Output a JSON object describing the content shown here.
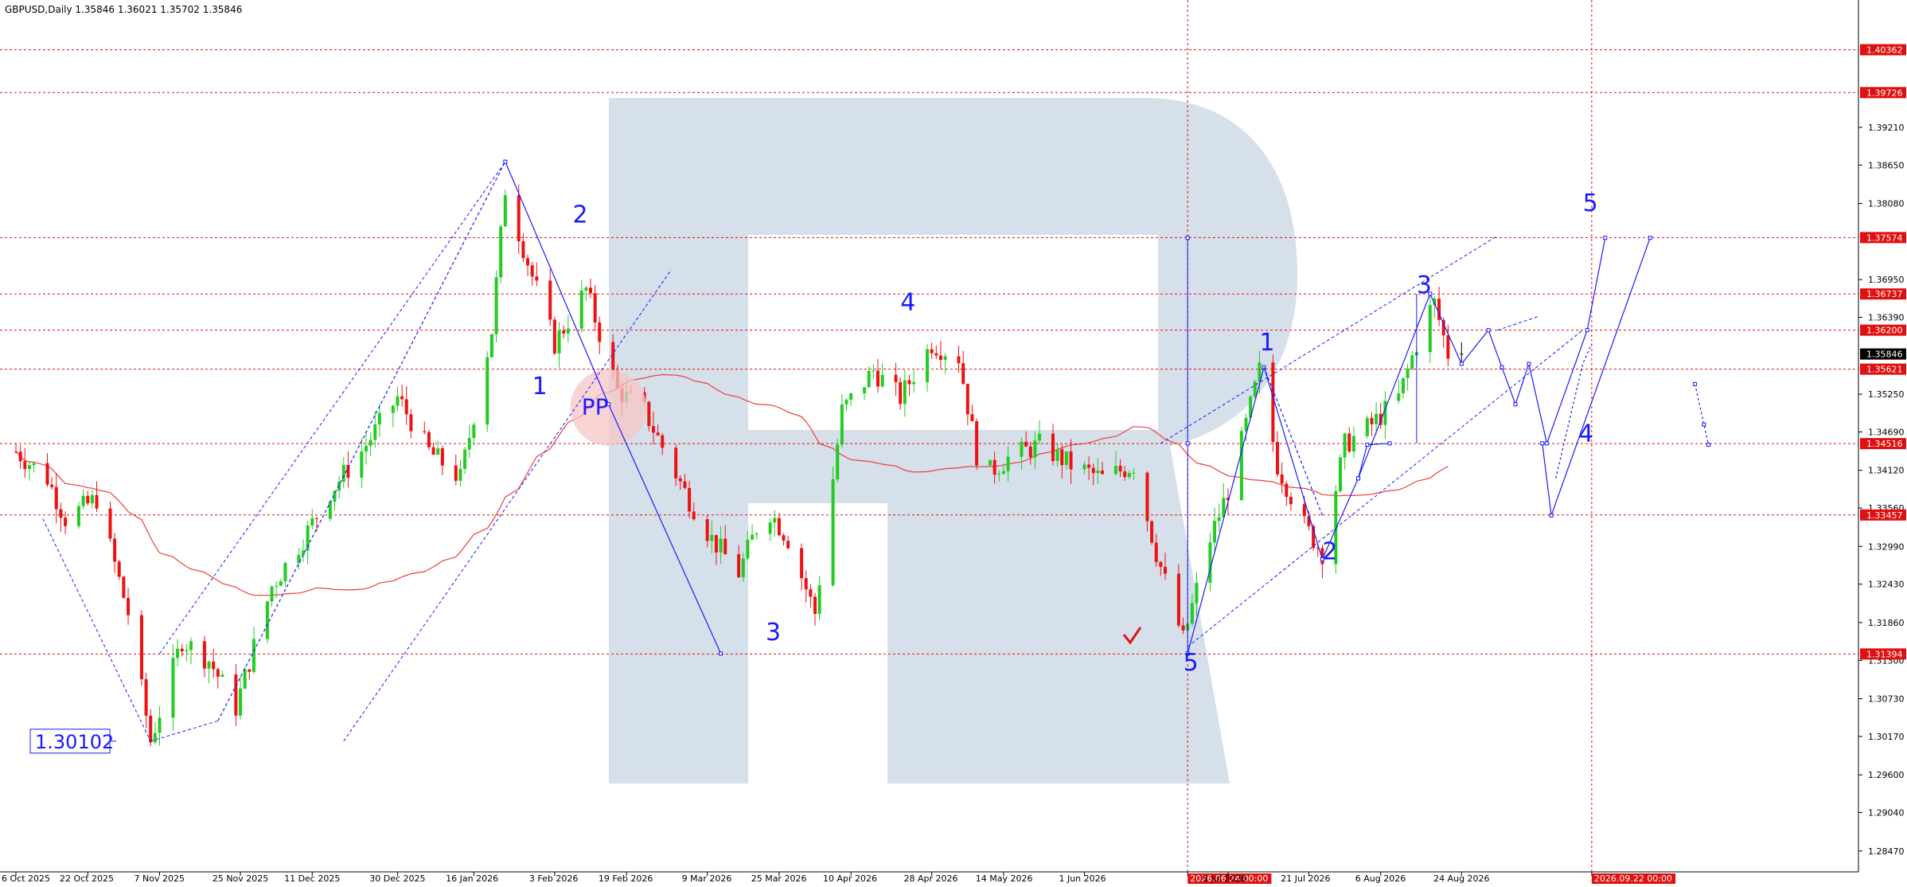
{
  "header": {
    "symbol_line": "GBPUSD,Daily  1.35846 1.36021 1.35702 1.35846"
  },
  "chart_data": {
    "type": "candlestick",
    "title": "GBPUSD,Daily",
    "ohlc": {
      "open": 1.35846,
      "high": 1.36021,
      "low": 1.35702,
      "close": 1.35846
    },
    "ylim": [
      1.2816,
      1.411
    ],
    "price_ticks": [
      "1.39210",
      "1.38650",
      "1.38080",
      "1.36950",
      "1.36390",
      "1.35250",
      "1.34690",
      "1.34120",
      "1.33560",
      "1.32990",
      "1.32430",
      "1.31860",
      "1.31300",
      "1.30730",
      "1.30170",
      "1.29600",
      "1.29040",
      "1.28470"
    ],
    "date_ticks": [
      "6 Oct 2025",
      "22 Oct 2025",
      "7 Nov 2025",
      "25 Nov 2025",
      "11 Dec 2025",
      "30 Dec 2025",
      "16 Jan 2026",
      "3 Feb 2026",
      "19 Feb 2026",
      "9 Mar 2026",
      "25 Mar 2026",
      "10 Apr 2026",
      "28 Apr 2026",
      "14 May 2026",
      "1 Jun 2026",
      "2026.06.24 00:00",
      "3 Jul 2026",
      "21 Jul 2026",
      "6 Aug 2026",
      "24 Aug 2026",
      "2026.09.22 00:00"
    ],
    "highlighted_dates": [
      "2026.06.24 00:00",
      "2026.09.22 00:00"
    ],
    "levels": [
      {
        "value": 1.40362,
        "label": "1.40362"
      },
      {
        "value": 1.39726,
        "label": "1.39726"
      },
      {
        "value": 1.37574,
        "label": "1.37574"
      },
      {
        "value": 1.36737,
        "label": "1.36737"
      },
      {
        "value": 1.362,
        "label": "1.36200"
      },
      {
        "value": 1.35621,
        "label": "1.35621"
      },
      {
        "value": 1.34516,
        "label": "1.34516"
      },
      {
        "value": 1.33457,
        "label": "1.33457"
      },
      {
        "value": 1.31394,
        "label": "1.31394"
      }
    ],
    "current_price": {
      "value": 1.35846,
      "label": "1.35846"
    },
    "price_callout": "1.30102",
    "pp_label": "PP",
    "wave_labels": [
      {
        "text": "1",
        "x": "29 Jan 2026",
        "y": 1.3525
      },
      {
        "text": "2",
        "x": "7 Feb 2026",
        "y": 1.378
      },
      {
        "text": "3",
        "x": "22 Mar 2026",
        "y": 1.316
      },
      {
        "text": "4",
        "x": "21 Apr 2026",
        "y": 1.365
      },
      {
        "text": "5",
        "x": "23 Jun 2026",
        "y": 1.3115
      },
      {
        "text": "1",
        "x": "10 Jul 2026",
        "y": 1.359
      },
      {
        "text": "2",
        "x": "24 Jul 2026",
        "y": 1.328
      },
      {
        "text": "3",
        "x": "14 Aug 2026",
        "y": 1.3675
      },
      {
        "text": "4",
        "x": "19 Sep 2026",
        "y": 1.3455
      },
      {
        "text": "5",
        "x": "20 Sep 2026",
        "y": 1.3797
      }
    ],
    "colors": {
      "bull": "#22cc22",
      "bear": "#ee1111",
      "ma": "#ee3b3b",
      "wave": "#1a1aff",
      "level": "#e01010",
      "grid": "#cccccc",
      "watermark": "#d6e0ea",
      "pp_zone": "#f6c6c6"
    }
  }
}
